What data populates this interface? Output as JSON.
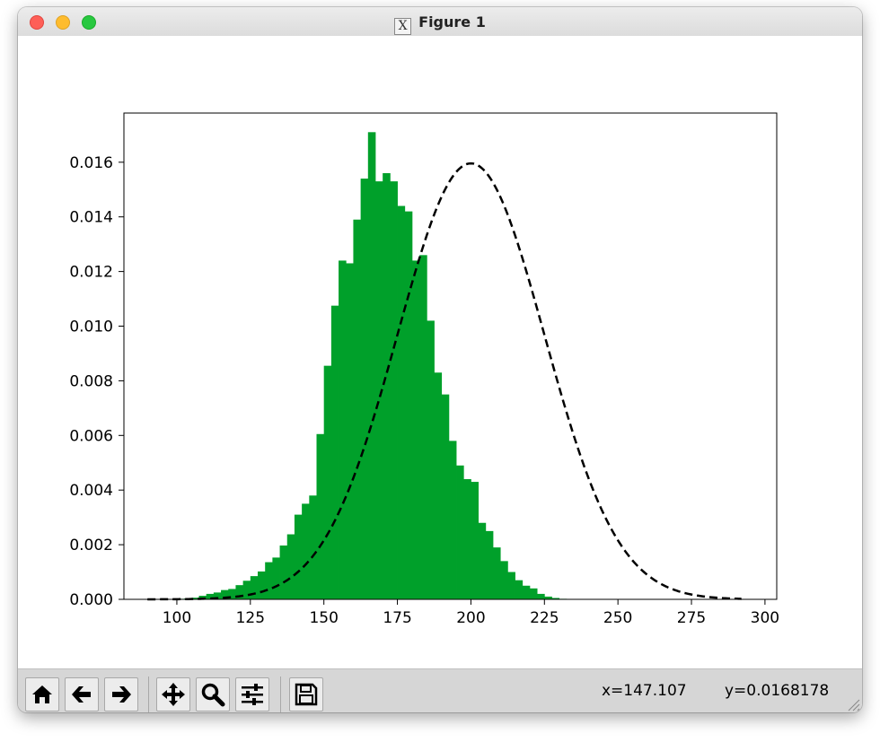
{
  "window": {
    "title": "Figure 1"
  },
  "chart_data": {
    "type": "bar",
    "bin_edges": [
      90,
      95,
      100,
      105,
      110,
      115,
      120,
      125,
      130,
      135,
      140,
      145,
      150,
      155,
      160,
      165,
      170,
      175,
      180,
      185,
      190,
      195,
      200,
      205,
      210,
      215,
      220,
      225,
      230,
      235,
      240,
      245,
      250,
      255,
      260,
      265,
      270,
      275,
      280,
      285,
      290
    ],
    "bin_width": 2.5,
    "values": [
      0.0,
      1e-05,
      1e-05,
      2e-05,
      3e-05,
      6e-05,
      0.00013,
      0.0002,
      0.00025,
      0.00034,
      0.00038,
      0.00052,
      0.00068,
      0.00085,
      0.00102,
      0.00136,
      0.00153,
      0.00197,
      0.00238,
      0.0031,
      0.0035,
      0.0038,
      0.00605,
      0.00855,
      0.01075,
      0.0124,
      0.0123,
      0.0139,
      0.0154,
      0.0171,
      0.0153,
      0.0156,
      0.0153,
      0.0144,
      0.0142,
      0.0124,
      0.0126,
      0.0102,
      0.0083,
      0.0075,
      0.0058,
      0.0049,
      0.0044,
      0.0043,
      0.0028,
      0.0025,
      0.0019,
      0.0014,
      0.001,
      0.0007,
      0.0005,
      0.0004,
      0.0002,
      0.0001,
      5e-05,
      2e-05
    ],
    "bar_start": 132.5,
    "bar_color": "#00a02a",
    "curve": {
      "type": "normal_pdf",
      "mean": 200,
      "std": 25,
      "x_range": [
        90,
        292
      ],
      "style": "dashed",
      "color": "#000000"
    },
    "xlim": [
      82,
      304
    ],
    "ylim": [
      0,
      0.0178
    ],
    "x_ticks": [
      100,
      125,
      150,
      175,
      200,
      225,
      250,
      275,
      300
    ],
    "x_tick_labels": [
      "100",
      "125",
      "150",
      "175",
      "200",
      "225",
      "250",
      "275",
      "300"
    ],
    "y_ticks": [
      0,
      0.002,
      0.004,
      0.006,
      0.008,
      0.01,
      0.012,
      0.014,
      0.016
    ],
    "y_tick_labels": [
      "0.000",
      "0.002",
      "0.004",
      "0.006",
      "0.008",
      "0.010",
      "0.012",
      "0.014",
      "0.016"
    ],
    "title": "",
    "xlabel": "",
    "ylabel": "",
    "grid": false
  },
  "toolbar": {
    "buttons": [
      {
        "name": "home",
        "icon": "home-icon"
      },
      {
        "name": "back",
        "icon": "arrow-left-icon"
      },
      {
        "name": "forward",
        "icon": "arrow-right-icon"
      },
      {
        "name": "pan",
        "icon": "move-icon"
      },
      {
        "name": "zoom",
        "icon": "magnifier-icon"
      },
      {
        "name": "configure-subplots",
        "icon": "sliders-icon"
      },
      {
        "name": "save",
        "icon": "floppy-disk-icon"
      }
    ],
    "x_readout": "x=147.107",
    "y_readout": "y=0.0168178"
  }
}
